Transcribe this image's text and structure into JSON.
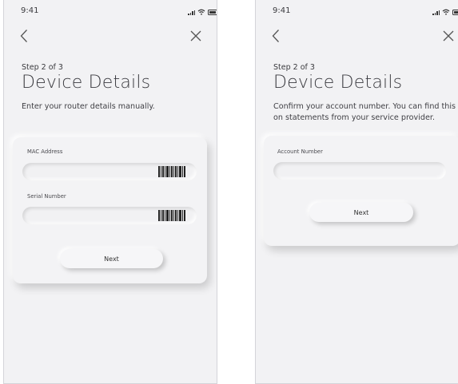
{
  "screens": [
    {
      "status": {
        "time": "9:41"
      },
      "step": "Step 2 of 3",
      "title": "Device Details",
      "description": "Enter your router details manually.",
      "fields": [
        {
          "label": "MAC Address",
          "value": "",
          "icon": "barcode-icon"
        },
        {
          "label": "Serial Number",
          "value": "",
          "icon": "barcode-icon"
        }
      ],
      "next_label": "Next"
    },
    {
      "status": {
        "time": "9:41"
      },
      "step": "Step 2 of 3",
      "title": "Device Details",
      "description": "Confirm your account number. You can find this on statements from your service provider.",
      "fields": [
        {
          "label": "Account Number",
          "value": ""
        }
      ],
      "next_label": "Next"
    }
  ],
  "icons": {
    "back": "chevron-left-icon",
    "close": "close-icon",
    "signal": "signal-icon",
    "wifi": "wifi-icon",
    "battery": "battery-icon"
  },
  "colors": {
    "screen_background": "#f2f2f4",
    "text": "#3a3a3f"
  }
}
